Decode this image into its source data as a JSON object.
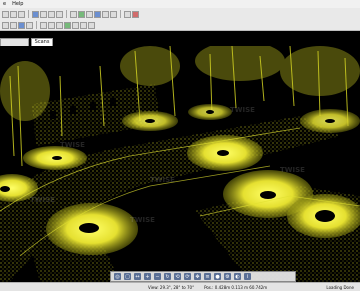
{
  "menubar": {
    "items": [
      "e",
      "Help"
    ]
  },
  "tabs": [
    {
      "label": ""
    },
    {
      "label": "Scans"
    }
  ],
  "statusbar": {
    "view": "View: 29.3°, 28° to 70°",
    "position": "Pos.: 0.428m 0.113 m 60.742m",
    "state": "Loading Done"
  },
  "colors": {
    "points": "#d8d822",
    "background": "#000000",
    "ui": "#e9e9e9"
  },
  "bottom_toolbar": {
    "icons": [
      "target-icon",
      "fullscreen-icon",
      "measure-icon",
      "zoom-in-icon",
      "zoom-out-icon",
      "rotate-icon",
      "rotate-left-icon",
      "rotate-right-icon",
      "pan-icon",
      "layers-icon",
      "sphere-icon",
      "settings-icon",
      "color-icon",
      "info-icon"
    ]
  }
}
